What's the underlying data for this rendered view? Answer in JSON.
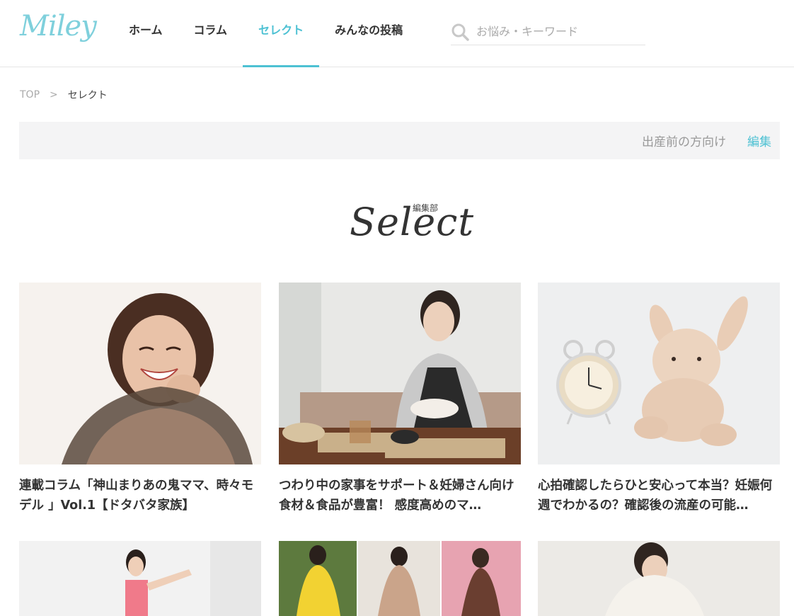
{
  "header": {
    "logo": "Miley",
    "nav": [
      {
        "label": "ホーム",
        "active": false
      },
      {
        "label": "コラム",
        "active": false
      },
      {
        "label": "セレクト",
        "active": true
      },
      {
        "label": "みんなの投稿",
        "active": false
      }
    ],
    "search_placeholder": "お悩み・キーワード"
  },
  "breadcrumb": {
    "top": "TOP",
    "separator": ">",
    "current": "セレクト"
  },
  "filter": {
    "label": "出産前の方向け",
    "edit": "編集"
  },
  "section": {
    "subtitle": "編集部",
    "title": "Select"
  },
  "cards": [
    {
      "title": "連載コラム「神山まりあの鬼ママ、時々モデル 」Vol.1【ドタバタ家族】"
    },
    {
      "title": "つわり中の家事をサポート＆妊婦さん向け食材＆食品が豊富！ 感度高めのマ…"
    },
    {
      "title": "心拍確認したらひと安心って本当？妊娠何週でわかるの？確認後の流産の可能…"
    }
  ],
  "colors": {
    "accent": "#4dc1d3",
    "logo": "#7fd0dc"
  }
}
